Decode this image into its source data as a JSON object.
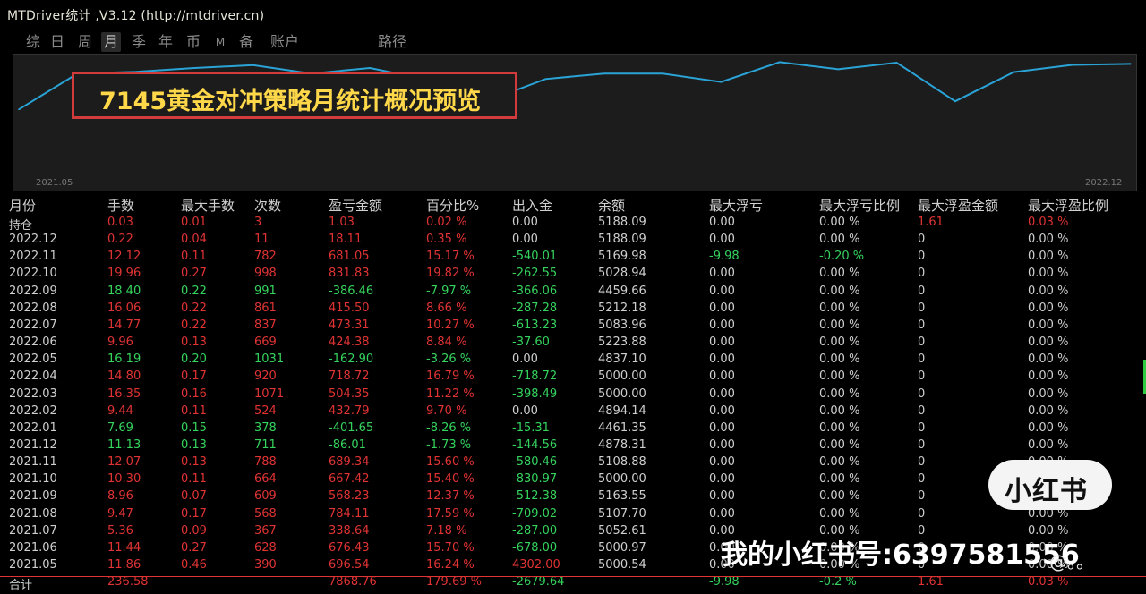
{
  "window": {
    "title": "MTDriver统计 ,V3.12 (http://mtdriver.cn)"
  },
  "tabs": [
    {
      "label": "综",
      "active": false
    },
    {
      "label": "日",
      "active": false
    },
    {
      "label": "周",
      "active": false
    },
    {
      "label": "月",
      "active": true
    },
    {
      "label": "季",
      "active": false
    },
    {
      "label": "年",
      "active": false
    },
    {
      "label": "币",
      "active": false
    },
    {
      "label": "M",
      "active": false
    },
    {
      "label": "备",
      "active": false
    },
    {
      "label": "账户",
      "active": false
    },
    {
      "label": "路径",
      "active": false
    }
  ],
  "overlay": {
    "text": "7145黄金对冲策略月统计概况预览"
  },
  "chart_data": {
    "type": "line",
    "x": [
      "2021.05",
      "2021.06",
      "2021.07",
      "2021.08",
      "2021.09",
      "2021.10",
      "2021.11",
      "2021.12",
      "2022.01",
      "2022.02",
      "2022.03",
      "2022.04",
      "2022.05",
      "2022.06",
      "2022.07",
      "2022.08",
      "2022.09",
      "2022.10",
      "2022.11",
      "2022.12"
    ],
    "series": [
      {
        "values": [
          4302.0,
          4998.97,
          5033.0,
          5107.7,
          5163.55,
          5000.0,
          5108.88,
          4878.31,
          4461.35,
          4894.14,
          5000.0,
          5000.0,
          4837.1,
          5223.88,
          5083.96,
          5212.18,
          4459.66,
          5028.94,
          5169.98,
          5188.09
        ]
      }
    ],
    "xlabel_start": "2021.05",
    "xlabel_end": "2022.12",
    "line_color": "#2aa3d6"
  },
  "table": {
    "headers": [
      "月份",
      "手数",
      "最大手数",
      "次数",
      "盈亏金额",
      "百分比%",
      "出入金",
      "余额",
      "最大浮亏",
      "最大浮亏比例",
      "最大浮盈金额",
      "最大浮盈比例"
    ],
    "rows": [
      {
        "c": [
          "持仓",
          "0.03",
          "0.01",
          "3",
          "1.03",
          "0.02 %",
          "0.00",
          "5188.09",
          "0.00",
          "0.00 %",
          "1.61",
          "0.03 %"
        ],
        "k": [
          "w",
          "r",
          "r",
          "r",
          "r",
          "r",
          "w",
          "w",
          "w",
          "w",
          "r",
          "r"
        ]
      },
      {
        "c": [
          "2022.12",
          "0.22",
          "0.04",
          "11",
          "18.11",
          "0.35 %",
          "0.00",
          "5188.09",
          "0.00",
          "0.00 %",
          "0",
          "0.00 %"
        ],
        "k": [
          "w",
          "r",
          "r",
          "r",
          "r",
          "r",
          "w",
          "w",
          "w",
          "w",
          "w",
          "w"
        ]
      },
      {
        "c": [
          "2022.11",
          "12.12",
          "0.11",
          "782",
          "681.05",
          "15.17 %",
          "-540.01",
          "5169.98",
          "-9.98",
          "-0.20 %",
          "0",
          "0.00 %"
        ],
        "k": [
          "w",
          "r",
          "r",
          "r",
          "r",
          "r",
          "g",
          "w",
          "g",
          "g",
          "w",
          "w"
        ]
      },
      {
        "c": [
          "2022.10",
          "19.96",
          "0.27",
          "998",
          "831.83",
          "19.82 %",
          "-262.55",
          "5028.94",
          "0.00",
          "0.00 %",
          "0",
          "0.00 %"
        ],
        "k": [
          "w",
          "r",
          "r",
          "r",
          "r",
          "r",
          "g",
          "w",
          "w",
          "w",
          "w",
          "w"
        ]
      },
      {
        "c": [
          "2022.09",
          "18.40",
          "0.22",
          "991",
          "-386.46",
          "-7.97 %",
          "-366.06",
          "4459.66",
          "0.00",
          "0.00 %",
          "0",
          "0.00 %"
        ],
        "k": [
          "w",
          "g",
          "g",
          "g",
          "g",
          "g",
          "g",
          "w",
          "w",
          "w",
          "w",
          "w"
        ]
      },
      {
        "c": [
          "2022.08",
          "16.06",
          "0.22",
          "861",
          "415.50",
          "8.66 %",
          "-287.28",
          "5212.18",
          "0.00",
          "0.00 %",
          "0",
          "0.00 %"
        ],
        "k": [
          "w",
          "r",
          "r",
          "r",
          "r",
          "r",
          "g",
          "w",
          "w",
          "w",
          "w",
          "w"
        ]
      },
      {
        "c": [
          "2022.07",
          "14.77",
          "0.22",
          "837",
          "473.31",
          "10.27 %",
          "-613.23",
          "5083.96",
          "0.00",
          "0.00 %",
          "0",
          "0.00 %"
        ],
        "k": [
          "w",
          "r",
          "r",
          "r",
          "r",
          "r",
          "g",
          "w",
          "w",
          "w",
          "w",
          "w"
        ]
      },
      {
        "c": [
          "2022.06",
          "9.96",
          "0.13",
          "669",
          "424.38",
          "8.84 %",
          "-37.60",
          "5223.88",
          "0.00",
          "0.00 %",
          "0",
          "0.00 %"
        ],
        "k": [
          "w",
          "r",
          "r",
          "r",
          "r",
          "r",
          "g",
          "w",
          "w",
          "w",
          "w",
          "w"
        ]
      },
      {
        "c": [
          "2022.05",
          "16.19",
          "0.20",
          "1031",
          "-162.90",
          "-3.26 %",
          "0.00",
          "4837.10",
          "0.00",
          "0.00 %",
          "0",
          "0.00 %"
        ],
        "k": [
          "w",
          "g",
          "g",
          "g",
          "g",
          "g",
          "w",
          "w",
          "w",
          "w",
          "w",
          "w"
        ]
      },
      {
        "c": [
          "2022.04",
          "14.80",
          "0.17",
          "920",
          "718.72",
          "16.79 %",
          "-718.72",
          "5000.00",
          "0.00",
          "0.00 %",
          "0",
          "0.00 %"
        ],
        "k": [
          "w",
          "r",
          "r",
          "r",
          "r",
          "r",
          "g",
          "w",
          "w",
          "w",
          "w",
          "w"
        ]
      },
      {
        "c": [
          "2022.03",
          "16.35",
          "0.16",
          "1071",
          "504.35",
          "11.22 %",
          "-398.49",
          "5000.00",
          "0.00",
          "0.00 %",
          "0",
          "0.00 %"
        ],
        "k": [
          "w",
          "r",
          "r",
          "r",
          "r",
          "r",
          "g",
          "w",
          "w",
          "w",
          "w",
          "w"
        ]
      },
      {
        "c": [
          "2022.02",
          "9.44",
          "0.11",
          "524",
          "432.79",
          "9.70 %",
          "0.00",
          "4894.14",
          "0.00",
          "0.00 %",
          "0",
          "0.00 %"
        ],
        "k": [
          "w",
          "r",
          "r",
          "r",
          "r",
          "r",
          "w",
          "w",
          "w",
          "w",
          "w",
          "w"
        ]
      },
      {
        "c": [
          "2022.01",
          "7.69",
          "0.15",
          "378",
          "-401.65",
          "-8.26 %",
          "-15.31",
          "4461.35",
          "0.00",
          "0.00 %",
          "0",
          "0.00 %"
        ],
        "k": [
          "w",
          "g",
          "g",
          "g",
          "g",
          "g",
          "g",
          "w",
          "w",
          "w",
          "w",
          "w"
        ]
      },
      {
        "c": [
          "2021.12",
          "11.13",
          "0.13",
          "711",
          "-86.01",
          "-1.73 %",
          "-144.56",
          "4878.31",
          "0.00",
          "0.00 %",
          "0",
          "0.00 %"
        ],
        "k": [
          "w",
          "g",
          "g",
          "g",
          "g",
          "g",
          "g",
          "w",
          "w",
          "w",
          "w",
          "w"
        ]
      },
      {
        "c": [
          "2021.11",
          "12.07",
          "0.13",
          "788",
          "689.34",
          "15.60 %",
          "-580.46",
          "5108.88",
          "0.00",
          "0.00 %",
          "0",
          "0.00 %"
        ],
        "k": [
          "w",
          "r",
          "r",
          "r",
          "r",
          "r",
          "g",
          "w",
          "w",
          "w",
          "w",
          "w"
        ]
      },
      {
        "c": [
          "2021.10",
          "10.30",
          "0.11",
          "664",
          "667.42",
          "15.40 %",
          "-830.97",
          "5000.00",
          "0.00",
          "0.00 %",
          "0",
          "0.00 %"
        ],
        "k": [
          "w",
          "r",
          "r",
          "r",
          "r",
          "r",
          "g",
          "w",
          "w",
          "w",
          "w",
          "w"
        ]
      },
      {
        "c": [
          "2021.09",
          "8.96",
          "0.07",
          "609",
          "568.23",
          "12.37 %",
          "-512.38",
          "5163.55",
          "0.00",
          "0.00 %",
          "0",
          "0.00 %"
        ],
        "k": [
          "w",
          "r",
          "r",
          "r",
          "r",
          "r",
          "g",
          "w",
          "w",
          "w",
          "w",
          "w"
        ]
      },
      {
        "c": [
          "2021.08",
          "9.47",
          "0.17",
          "568",
          "784.11",
          "17.59 %",
          "-709.02",
          "5107.70",
          "0.00",
          "0.00 %",
          "0",
          "0.00 %"
        ],
        "k": [
          "w",
          "r",
          "r",
          "r",
          "r",
          "r",
          "g",
          "w",
          "w",
          "w",
          "w",
          "w"
        ]
      },
      {
        "c": [
          "2021.07",
          "5.36",
          "0.09",
          "367",
          "338.64",
          "7.18 %",
          "-287.00",
          "5052.61",
          "0.00",
          "0.00 %",
          "0",
          "0.00 %"
        ],
        "k": [
          "w",
          "r",
          "r",
          "r",
          "r",
          "r",
          "g",
          "w",
          "w",
          "w",
          "w",
          "w"
        ]
      },
      {
        "c": [
          "2021.06",
          "11.44",
          "0.27",
          "628",
          "676.43",
          "15.70 %",
          "-678.00",
          "5000.97",
          "0.00",
          "0.00 %",
          "0",
          "0.00 %"
        ],
        "k": [
          "w",
          "r",
          "r",
          "r",
          "r",
          "r",
          "g",
          "w",
          "w",
          "w",
          "w",
          "w"
        ]
      },
      {
        "c": [
          "2021.05",
          "11.86",
          "0.46",
          "390",
          "696.54",
          "16.24 %",
          "4302.00",
          "5000.54",
          "0.00",
          "0.00 %",
          "0",
          "0.00 %"
        ],
        "k": [
          "w",
          "r",
          "r",
          "r",
          "r",
          "r",
          "r",
          "w",
          "w",
          "w",
          "w",
          "w"
        ]
      },
      {
        "c": [
          "合计",
          "236.58",
          "",
          "",
          "7868.76",
          "179.69 %",
          "-2679.64",
          "",
          "-9.98",
          "-0.2 %",
          "1.61",
          "0.03 %"
        ],
        "k": [
          "w",
          "r",
          "r",
          "r",
          "r",
          "r",
          "g",
          "w",
          "g",
          "g",
          "r",
          "r"
        ]
      }
    ]
  },
  "watermark": {
    "logo": "小红书",
    "text": "我的小红书号:6397581556",
    "sub": "@。。"
  },
  "colors": {
    "positive": "#e03333",
    "negative": "#35d35d",
    "line": "#2aa3d6"
  }
}
